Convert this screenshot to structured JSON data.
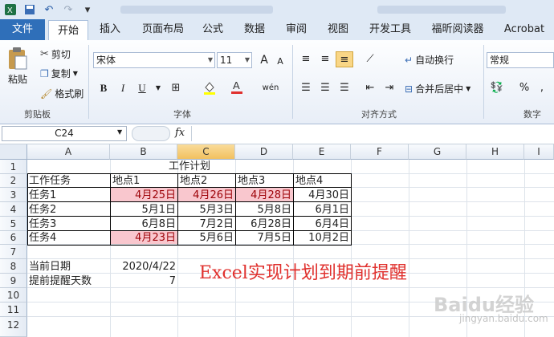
{
  "qat": {
    "undo_label": "↶",
    "redo_label": "↷",
    "customize_label": "▾"
  },
  "tabs": [
    "文件",
    "开始",
    "插入",
    "页面布局",
    "公式",
    "数据",
    "审阅",
    "视图",
    "开发工具",
    "福昕阅读器",
    "Acrobat"
  ],
  "active_tab": "开始",
  "clipboard": {
    "paste": "粘贴",
    "cut": "剪切",
    "copy": "复制",
    "format_painter": "格式刷",
    "group": "剪贴板"
  },
  "font": {
    "name": "宋体",
    "size": "11",
    "grow": "A",
    "shrink": "A",
    "bold": "B",
    "italic": "I",
    "underline": "U",
    "group": "字体"
  },
  "alignment": {
    "wrap": "自动换行",
    "merge": "合并后居中",
    "group": "对齐方式"
  },
  "number": {
    "format": "常规",
    "percent": "%",
    "comma": ",",
    "group": "数字"
  },
  "formula_bar": {
    "name_box": "C24",
    "fx": "fx",
    "value": ""
  },
  "columns": [
    "A",
    "B",
    "C",
    "D",
    "E",
    "F",
    "G",
    "H",
    "I"
  ],
  "selected_column": "C",
  "rows": [
    "1",
    "2",
    "3",
    "4",
    "5",
    "6",
    "7",
    "8",
    "9",
    "10",
    "11",
    "12"
  ],
  "sheet": {
    "title": "工作计划",
    "header": [
      "工作任务",
      "地点1",
      "地点2",
      "地点3",
      "地点4"
    ],
    "tasks": [
      {
        "name": "任务1",
        "values": [
          "4月25日",
          "4月26日",
          "4月28日",
          "4月30日"
        ],
        "highlight": [
          true,
          true,
          true,
          false
        ]
      },
      {
        "name": "任务2",
        "values": [
          "5月1日",
          "5月3日",
          "5月8日",
          "6月1日"
        ],
        "highlight": [
          false,
          false,
          false,
          false
        ]
      },
      {
        "name": "任务3",
        "values": [
          "6月8日",
          "7月2日",
          "6月28日",
          "6月4日"
        ],
        "highlight": [
          false,
          false,
          false,
          false
        ]
      },
      {
        "name": "任务4",
        "values": [
          "4月23日",
          "5月6日",
          "7月5日",
          "10月2日"
        ],
        "highlight": [
          true,
          false,
          false,
          false
        ]
      }
    ],
    "current_date_label": "当前日期",
    "current_date": "2020/4/22",
    "reminder_days_label": "提前提醒天数",
    "reminder_days": "7"
  },
  "overlay_text": "Excel实现计划到期前提醒",
  "watermark": "Baidu经验",
  "watermark_sub": "jingyan.baidu.com",
  "colors": {
    "highlight_fill": "#f9c7ce",
    "highlight_text": "#9c0006",
    "overlay": "#e0312e",
    "file_tab": "#2f6fb9"
  }
}
